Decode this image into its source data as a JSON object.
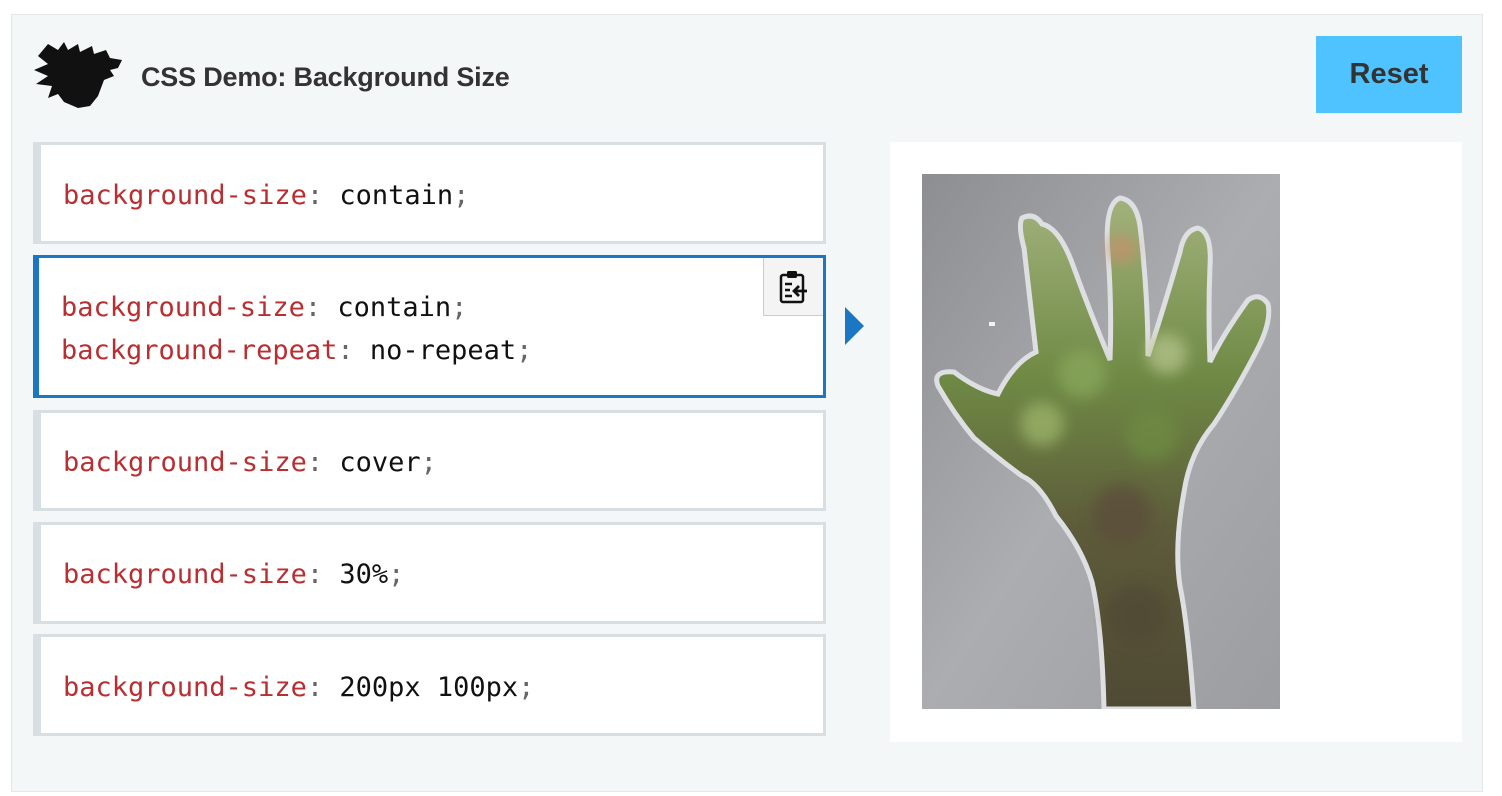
{
  "header": {
    "title": "CSS Demo: Background Size",
    "reset_label": "Reset"
  },
  "choices": [
    {
      "lines": [
        {
          "prop": "background-size",
          "value": "contain"
        }
      ]
    },
    {
      "lines": [
        {
          "prop": "background-size",
          "value": "contain"
        },
        {
          "prop": "background-repeat",
          "value": "no-repeat"
        }
      ]
    },
    {
      "lines": [
        {
          "prop": "background-size",
          "value": "cover"
        }
      ]
    },
    {
      "lines": [
        {
          "prop": "background-size",
          "value": "30%"
        }
      ]
    },
    {
      "lines": [
        {
          "prop": "background-size",
          "value": "200px 100px"
        }
      ]
    }
  ],
  "selected_choice": 2,
  "icons": {
    "logo": "dinosaur-logo-icon",
    "copy": "clipboard-copy-icon",
    "selection": "triangle-right-icon",
    "output": "hand-cutout-photo"
  },
  "colors": {
    "accent": "#1b76c4",
    "reset_button": "#4fc3ff",
    "property": "#b92e31",
    "panel_bg": "#f4f7f8"
  }
}
